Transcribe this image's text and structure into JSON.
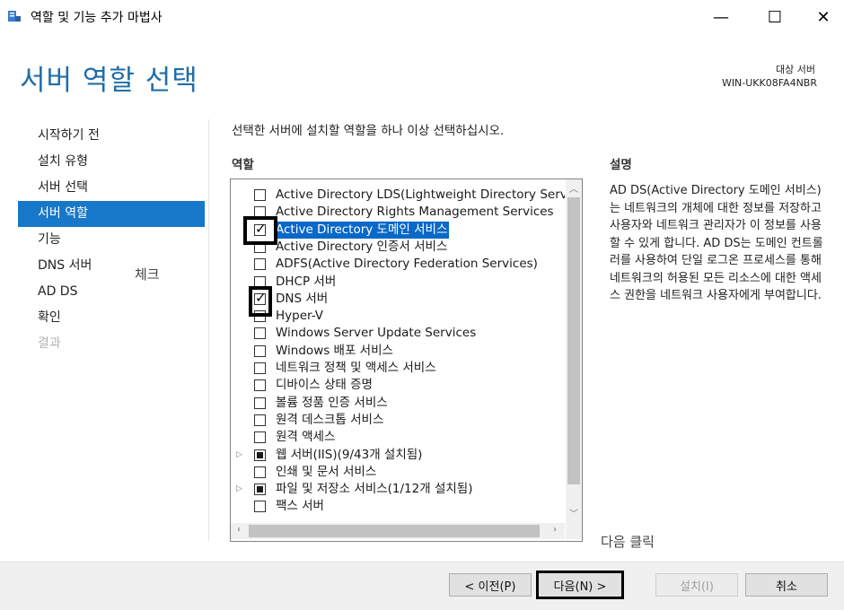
{
  "window": {
    "title": "역할 및 기능 추가 마법사",
    "minimize_glyph": "—",
    "maximize_glyph": "☐",
    "close_glyph": "✕"
  },
  "header": {
    "title": "서버 역할 선택",
    "target_label": "대상 서버",
    "target_value": "WIN-UKK08FA4NBR"
  },
  "nav": {
    "items": [
      {
        "label": "시작하기 전"
      },
      {
        "label": "설치 유형"
      },
      {
        "label": "서버 선택"
      },
      {
        "label": "서버 역할"
      },
      {
        "label": "기능"
      },
      {
        "label": "DNS 서버"
      },
      {
        "label": "AD DS"
      },
      {
        "label": "확인"
      },
      {
        "label": "결과"
      }
    ]
  },
  "annotations": {
    "check_note": "체크",
    "next_note": "다음 클릭"
  },
  "main": {
    "instruction": "선택한 서버에 설치할 역할을 하나 이상 선택하십시오.",
    "roles_heading": "역할",
    "description_heading": "설명",
    "description": "AD DS(Active Directory 도메인 서비스)는 네트워크의 개체에 대한 정보를 저장하고 사용자와 네트워크 관리자가 이 정보를 사용할 수 있게 합니다. AD DS는 도메인 컨트롤러를 사용하여 단일 로그온 프로세스를 통해 네트워크의 허용된 모든 리소스에 대한 액세스 권한을 네트워크 사용자에게 부여합니다.",
    "roles": [
      {
        "label": "Active Directory LDS(Lightweight Directory Services)",
        "state": "unchecked",
        "expandable": false
      },
      {
        "label": "Active Directory Rights Management Services",
        "state": "unchecked",
        "expandable": false
      },
      {
        "label": "Active Directory 도메인 서비스",
        "state": "checked",
        "expandable": false,
        "selected": true
      },
      {
        "label": "Active Directory 인증서 서비스",
        "state": "unchecked",
        "expandable": false
      },
      {
        "label": "ADFS(Active Directory Federation Services)",
        "state": "unchecked",
        "expandable": false
      },
      {
        "label": "DHCP 서버",
        "state": "unchecked",
        "expandable": false
      },
      {
        "label": "DNS 서버",
        "state": "checked",
        "expandable": false
      },
      {
        "label": "Hyper-V",
        "state": "unchecked",
        "expandable": false
      },
      {
        "label": "Windows Server Update Services",
        "state": "unchecked",
        "expandable": false
      },
      {
        "label": "Windows 배포 서비스",
        "state": "unchecked",
        "expandable": false
      },
      {
        "label": "네트워크 정책 및 액세스 서비스",
        "state": "unchecked",
        "expandable": false
      },
      {
        "label": "디바이스 상태 증명",
        "state": "unchecked",
        "expandable": false
      },
      {
        "label": "볼륨 정품 인증 서비스",
        "state": "unchecked",
        "expandable": false
      },
      {
        "label": "원격 데스크톱 서비스",
        "state": "unchecked",
        "expandable": false
      },
      {
        "label": "원격 액세스",
        "state": "unchecked",
        "expandable": false
      },
      {
        "label": "웹 서버(IIS)(9/43개 설치됨)",
        "state": "partial",
        "expandable": true
      },
      {
        "label": "인쇄 및 문서 서비스",
        "state": "unchecked",
        "expandable": false
      },
      {
        "label": "파일 및 저장소 서비스(1/12개 설치됨)",
        "state": "partial",
        "expandable": true
      },
      {
        "label": "팩스 서버",
        "state": "unchecked",
        "expandable": false
      }
    ]
  },
  "buttons": {
    "previous": "< 이전(P)",
    "next": "다음(N) >",
    "install": "설치(I)",
    "cancel": "취소"
  }
}
